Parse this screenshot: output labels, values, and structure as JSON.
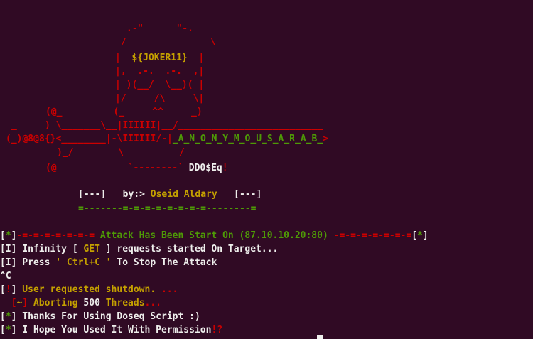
{
  "colors": {
    "background": "#300a24",
    "red": "#cc0000",
    "yellow": "#c4a000",
    "green": "#4e9a06",
    "white": "#eeeeec"
  },
  "banner": {
    "l1": ".-\"      \"-.",
    "l2a": "/",
    "l2b": "\\",
    "l3a": "|  ",
    "l3b": "${JOKER11}",
    "l3c": "  |",
    "l4": "|,  .-.  .-.  ,|",
    "l5": "| )(__/  \\__)( |",
    "l6": "|/     /\\     \\|",
    "l7a": "(@_",
    "l7b": "(_     ^^     _)",
    "l8": "_     ) \\_______\\__|IIIIII|__/__________________________",
    "l9a": "(_)@8@8{}<________|-\\IIIIII/-|",
    "l9b": "_A_N_O_N_Y_M_O_U_S_A_R_A_B_",
    "l9c": ">",
    "l10": ")_/        \\          /",
    "l11a": "(@",
    "l11b": "`--------`",
    "l11c": " DD0$Eq",
    "l11d": "!",
    "credit_open": "[---]",
    "credit_by": "   by:> ",
    "credit_name": "Oseid Aldary",
    "credit_close": "   [---]",
    "separator": "=-------=-=-=-=-=-=-=-=--------="
  },
  "output": {
    "line1": {
      "b1": "[",
      "star": "*",
      "b2": "]",
      "sep1": "-=-=-=-=-=-=-= ",
      "msg": "Attack Has Been Start On (87.10.10.20:80)",
      "sep2": " -=-=-=-=-=-=-=",
      "b3": "[",
      "star2": "*",
      "b4": "]"
    },
    "line2": {
      "prefix": "[I]",
      "t1": " Infinity [ ",
      "get": "GET",
      "t2": " ] requests started On Target..."
    },
    "line3": {
      "prefix": "[I]",
      "t1": " Press ",
      "key": "' Ctrl+C '",
      "t2": " To Stop The Attack"
    },
    "line4": "^C",
    "line5": {
      "b1": "[",
      "mark": "!",
      "b2": "]",
      "msg": " User requested shutdown. ",
      "dots": "..."
    },
    "line6": {
      "indent": "  ",
      "b1": "[",
      "mark": "~",
      "b2": "]",
      "t1": " Aborting ",
      "count": "500",
      "t2": " Threads",
      "dots": "..."
    },
    "line7": {
      "b1": "[",
      "star": "*",
      "b2": "]",
      "msg": " Thanks For Using Doseq Script :)"
    },
    "line8": {
      "b1": "[",
      "star": "*",
      "b2": "]",
      "msg": " I Hope You Used It With Permission",
      "mark": "!?"
    }
  }
}
